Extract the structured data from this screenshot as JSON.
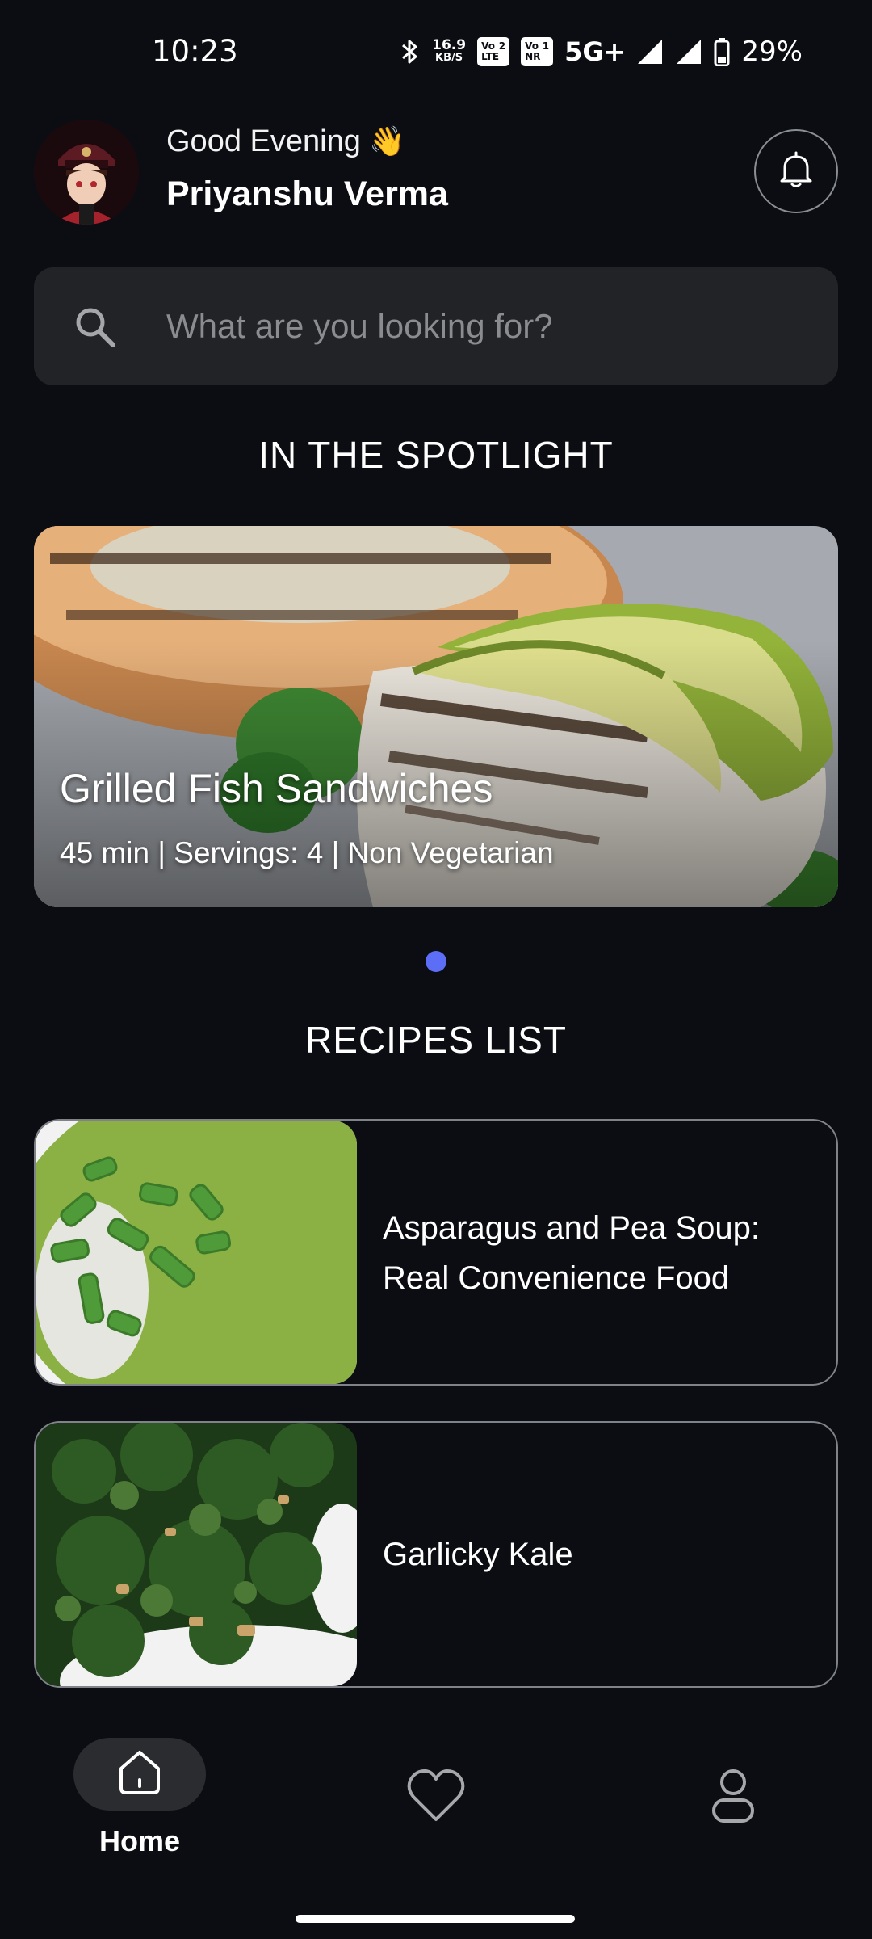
{
  "status_bar": {
    "time": "10:23",
    "net_speed_value": "16.9",
    "net_speed_unit": "KB/S",
    "sim1_top": "Vo",
    "sim1_slot": "2",
    "sim1_bottom": "LTE",
    "sim2_top": "Vo",
    "sim2_slot": "1",
    "sim2_bottom": "NR",
    "network": "5G+",
    "battery": "29%"
  },
  "header": {
    "greeting": "Good Evening",
    "greeting_emoji": "👋",
    "user_name": "Priyanshu Verma"
  },
  "search": {
    "placeholder": "What are you looking for?"
  },
  "spotlight": {
    "section_title": "IN THE SPOTLIGHT",
    "title": "Grilled Fish Sandwiches",
    "meta": "45 min | Servings: 4 | Non Vegetarian"
  },
  "recipes": {
    "section_title": "RECIPES LIST",
    "items": [
      {
        "title": "Asparagus and Pea Soup: Real Convenience Food"
      },
      {
        "title": "Garlicky Kale"
      }
    ]
  },
  "nav": {
    "home_label": "Home"
  },
  "colors": {
    "background": "#0b0d12",
    "accent_dot": "#5b6ef5",
    "search_bg": "#222326"
  }
}
